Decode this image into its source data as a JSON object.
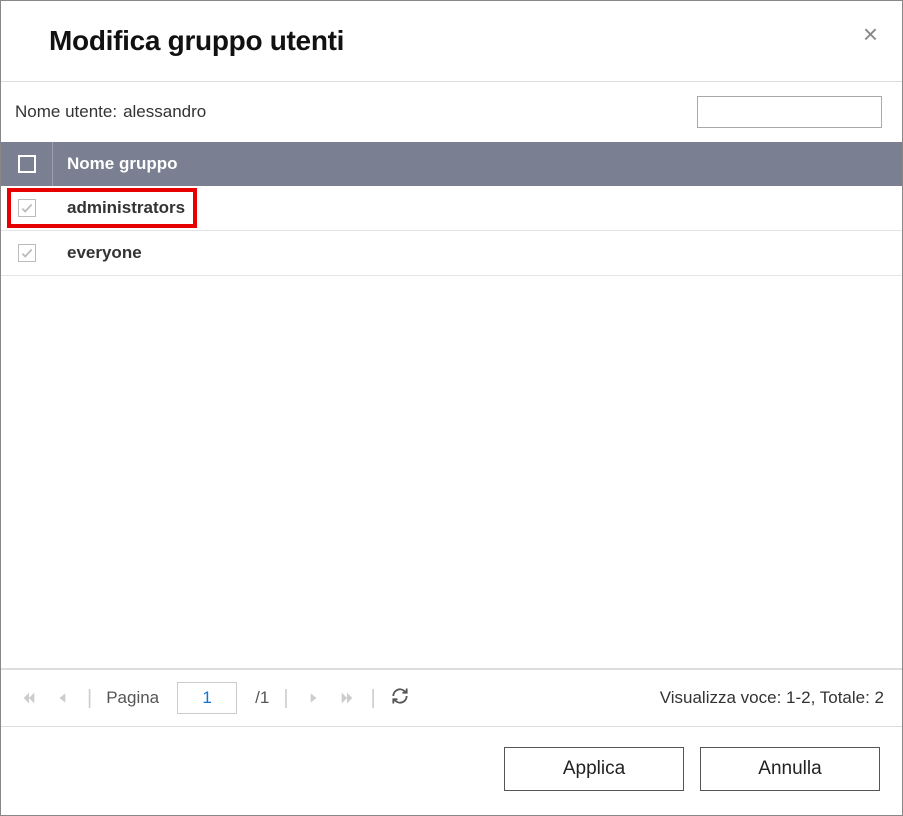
{
  "dialog": {
    "title": "Modifica gruppo utenti",
    "close_label": "×"
  },
  "subheader": {
    "label": "Nome utente:",
    "username": "alessandro",
    "search_placeholder": ""
  },
  "table": {
    "header_group_name": "Nome gruppo",
    "rows": [
      {
        "name": "administrators",
        "checked": true,
        "highlighted": true
      },
      {
        "name": "everyone",
        "checked": true,
        "highlighted": false
      }
    ]
  },
  "pager": {
    "page_label": "Pagina",
    "current_page": "1",
    "total_pages": "/1",
    "summary": "Visualizza voce: 1-2, Totale: 2"
  },
  "footer": {
    "apply": "Applica",
    "cancel": "Annulla"
  }
}
